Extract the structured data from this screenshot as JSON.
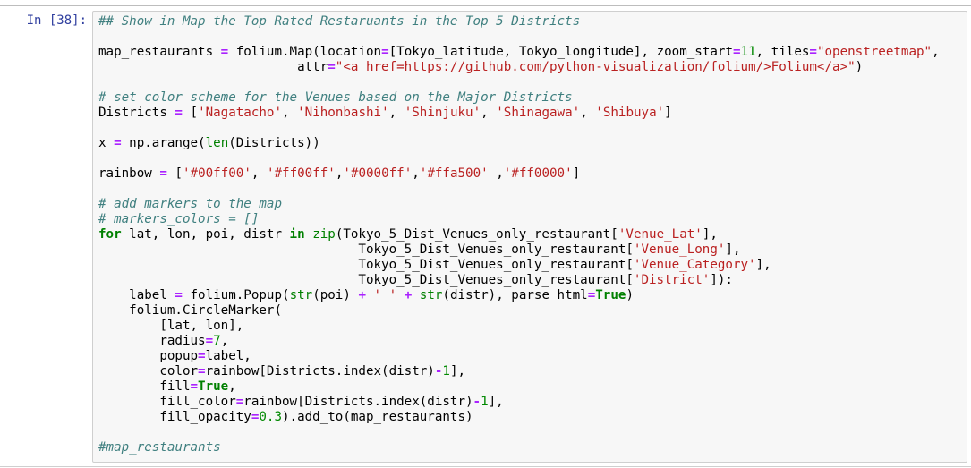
{
  "prompt": "In [38]:",
  "code_lines": [
    [
      [
        "c",
        "## Show in Map the Top Rated Restaruants in the Top 5 Districts"
      ]
    ],
    [],
    [
      [
        "",
        "map_restaurants "
      ],
      [
        "o",
        "="
      ],
      [
        "",
        " folium.Map(location"
      ],
      [
        "o",
        "="
      ],
      [
        "",
        "[Tokyo_latitude, Tokyo_longitude], zoom_start"
      ],
      [
        "o",
        "="
      ],
      [
        "n",
        "11"
      ],
      [
        "",
        ", tiles"
      ],
      [
        "o",
        "="
      ],
      [
        "s",
        "\"openstreetmap\""
      ],
      [
        "",
        ","
      ]
    ],
    [
      [
        "",
        "                          attr"
      ],
      [
        "o",
        "="
      ],
      [
        "s",
        "\"<a href=https://github.com/python-visualization/folium/>Folium</a>\""
      ],
      [
        "",
        ")"
      ]
    ],
    [],
    [
      [
        "c",
        "# set color scheme for the Venues based on the Major Districts"
      ]
    ],
    [
      [
        "",
        "Districts "
      ],
      [
        "o",
        "="
      ],
      [
        "",
        " ["
      ],
      [
        "s",
        "'Nagatacho'"
      ],
      [
        "",
        ", "
      ],
      [
        "s",
        "'Nihonbashi'"
      ],
      [
        "",
        ", "
      ],
      [
        "s",
        "'Shinjuku'"
      ],
      [
        "",
        ", "
      ],
      [
        "s",
        "'Shinagawa'"
      ],
      [
        "",
        ", "
      ],
      [
        "s",
        "'Shibuya'"
      ],
      [
        "",
        "]"
      ]
    ],
    [],
    [
      [
        "",
        "x "
      ],
      [
        "o",
        "="
      ],
      [
        "",
        " np.arange("
      ],
      [
        "b",
        "len"
      ],
      [
        "",
        "(Districts))"
      ]
    ],
    [],
    [
      [
        "",
        "rainbow "
      ],
      [
        "o",
        "="
      ],
      [
        "",
        " ["
      ],
      [
        "s",
        "'#00ff00'"
      ],
      [
        "",
        ", "
      ],
      [
        "s",
        "'#ff00ff'"
      ],
      [
        "",
        ","
      ],
      [
        "s",
        "'#0000ff'"
      ],
      [
        "",
        ","
      ],
      [
        "s",
        "'#ffa500'"
      ],
      [
        "",
        " ,"
      ],
      [
        "s",
        "'#ff0000'"
      ],
      [
        "",
        "]"
      ]
    ],
    [],
    [
      [
        "c",
        "# add markers to the map"
      ]
    ],
    [
      [
        "c",
        "# markers_colors = []"
      ]
    ],
    [
      [
        "k",
        "for"
      ],
      [
        "",
        " lat, lon, poi, distr "
      ],
      [
        "k",
        "in"
      ],
      [
        "",
        " "
      ],
      [
        "b",
        "zip"
      ],
      [
        "",
        "(Tokyo_5_Dist_Venues_only_restaurant["
      ],
      [
        "s",
        "'Venue_Lat'"
      ],
      [
        "",
        "],"
      ]
    ],
    [
      [
        "",
        "                                  Tokyo_5_Dist_Venues_only_restaurant["
      ],
      [
        "s",
        "'Venue_Long'"
      ],
      [
        "",
        "],"
      ]
    ],
    [
      [
        "",
        "                                  Tokyo_5_Dist_Venues_only_restaurant["
      ],
      [
        "s",
        "'Venue_Category'"
      ],
      [
        "",
        "],"
      ]
    ],
    [
      [
        "",
        "                                  Tokyo_5_Dist_Venues_only_restaurant["
      ],
      [
        "s",
        "'District'"
      ],
      [
        "",
        "]):"
      ]
    ],
    [
      [
        "",
        "    label "
      ],
      [
        "o",
        "="
      ],
      [
        "",
        " folium.Popup("
      ],
      [
        "b",
        "str"
      ],
      [
        "",
        "(poi) "
      ],
      [
        "o",
        "+"
      ],
      [
        "",
        " "
      ],
      [
        "s",
        "' '"
      ],
      [
        "",
        " "
      ],
      [
        "o",
        "+"
      ],
      [
        "",
        " "
      ],
      [
        "b",
        "str"
      ],
      [
        "",
        "(distr), parse_html"
      ],
      [
        "o",
        "="
      ],
      [
        "k",
        "True"
      ],
      [
        "",
        ")"
      ]
    ],
    [
      [
        "",
        "    folium.CircleMarker("
      ]
    ],
    [
      [
        "",
        "        [lat, lon],"
      ]
    ],
    [
      [
        "",
        "        radius"
      ],
      [
        "o",
        "="
      ],
      [
        "n",
        "7"
      ],
      [
        "",
        ","
      ]
    ],
    [
      [
        "",
        "        popup"
      ],
      [
        "o",
        "="
      ],
      [
        "",
        "label,"
      ]
    ],
    [
      [
        "",
        "        color"
      ],
      [
        "o",
        "="
      ],
      [
        "",
        "rainbow[Districts.index(distr)"
      ],
      [
        "o",
        "-"
      ],
      [
        "n",
        "1"
      ],
      [
        "",
        "],"
      ]
    ],
    [
      [
        "",
        "        fill"
      ],
      [
        "o",
        "="
      ],
      [
        "k",
        "True"
      ],
      [
        "",
        ","
      ]
    ],
    [
      [
        "",
        "        fill_color"
      ],
      [
        "o",
        "="
      ],
      [
        "",
        "rainbow[Districts.index(distr)"
      ],
      [
        "o",
        "-"
      ],
      [
        "n",
        "1"
      ],
      [
        "",
        "],"
      ]
    ],
    [
      [
        "",
        "        fill_opacity"
      ],
      [
        "o",
        "="
      ],
      [
        "n",
        "0.3"
      ],
      [
        "",
        "). add_to(map_restaurants)"
      ]
    ],
    [],
    [
      [
        "c",
        "#map_restaurants"
      ]
    ]
  ]
}
